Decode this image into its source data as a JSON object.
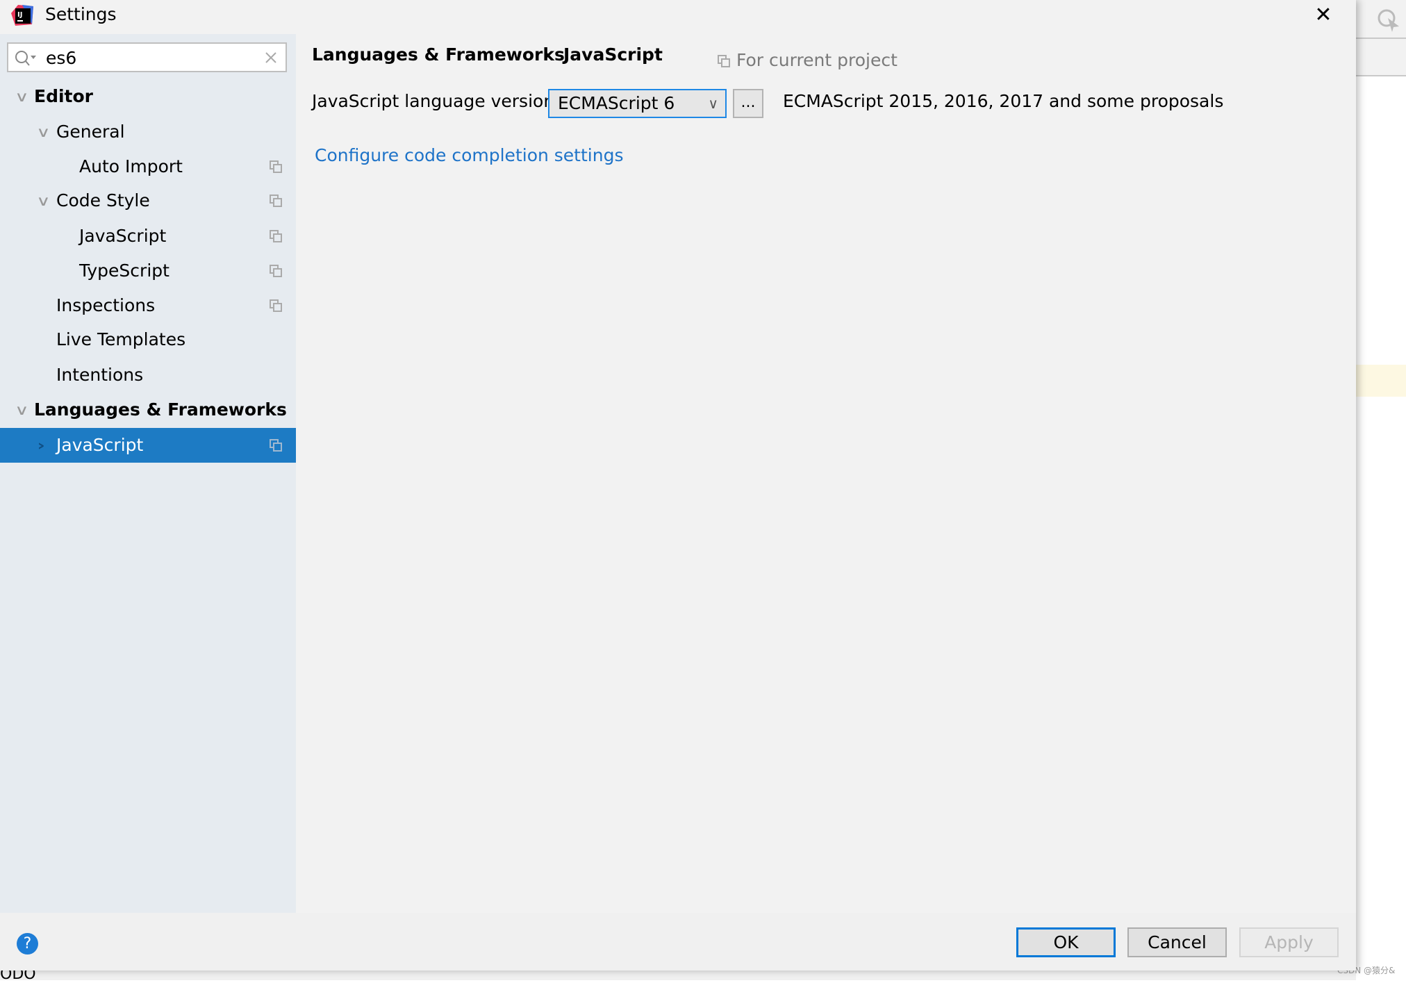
{
  "window": {
    "title": "Settings",
    "close_icon": "close-icon",
    "accent": "#1d7bc4"
  },
  "search": {
    "value": "es6"
  },
  "tree": [
    {
      "label": "Editor",
      "expanded": true,
      "bold": true
    },
    {
      "label": "General",
      "expanded": true
    },
    {
      "label": "Auto Import",
      "copy": true
    },
    {
      "label": "Code Style",
      "expanded": true,
      "copy": true
    },
    {
      "label": "JavaScript",
      "copy": true
    },
    {
      "label": "TypeScript",
      "copy": true
    },
    {
      "label": "Inspections",
      "copy": true
    },
    {
      "label": "Live Templates"
    },
    {
      "label": "Intentions"
    },
    {
      "label": "Languages & Frameworks",
      "expanded": true,
      "bold": true
    },
    {
      "label": "JavaScript",
      "expanded": false,
      "selected": true,
      "copy": true
    }
  ],
  "main": {
    "breadcrumb": [
      "Languages & Frameworks",
      "JavaScript"
    ],
    "breadcrumb_sep": "›",
    "scope": "For current project",
    "lang_label": "JavaScript language version",
    "lang_value": "ECMAScript 6",
    "more_label": "...",
    "lang_desc": "ECMAScript 2015, 2016, 2017 and some proposals",
    "link": "Configure code completion settings"
  },
  "footer": {
    "help": "?",
    "ok": "OK",
    "cancel": "Cancel",
    "apply": "Apply"
  },
  "background": {
    "odo": "ODO",
    "watermark": "CSDN @猿分&"
  }
}
